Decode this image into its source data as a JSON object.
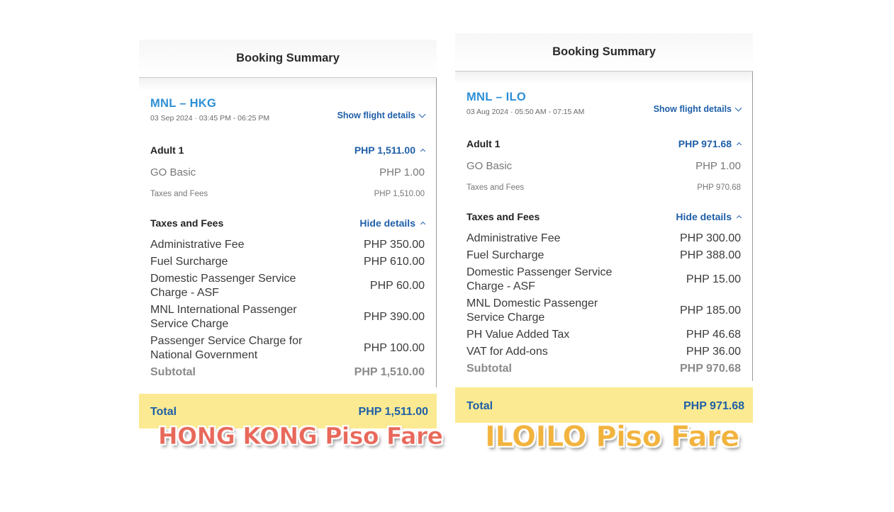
{
  "left": {
    "header": "Booking Summary",
    "route": "MNL – HKG",
    "flight_date": "03 Sep 2024 · 03:45 PM - 06:25 PM",
    "show_flight_details": "Show flight details",
    "adult_label": "Adult 1",
    "adult_amount": "PHP 1,511.00",
    "fare_label": "GO Basic",
    "fare_amount": "PHP 1.00",
    "taxes_label": "Taxes and Fees",
    "taxes_amount": "PHP 1,510.00",
    "taxes_head": "Taxes and Fees",
    "hide_details": "Hide details",
    "fees": [
      {
        "label": "Administrative Fee",
        "amount": "PHP 350.00"
      },
      {
        "label": "Fuel Surcharge",
        "amount": "PHP 610.00"
      },
      {
        "label": "Domestic Passenger Service Charge - ASF",
        "amount": "PHP 60.00"
      },
      {
        "label": "MNL International Passenger Service Charge",
        "amount": "PHP 390.00"
      },
      {
        "label": "Passenger Service Charge for National Government",
        "amount": "PHP 100.00"
      }
    ],
    "subtotal_label": "Subtotal",
    "subtotal_amount": "PHP 1,510.00",
    "total_label": "Total",
    "total_amount": "PHP 1,511.00",
    "caption": "HONG KONG Piso Fare"
  },
  "right": {
    "header": "Booking Summary",
    "route": "MNL – ILO",
    "flight_date": "03 Aug 2024 · 05:50 AM - 07:15 AM",
    "show_flight_details": "Show flight details",
    "adult_label": "Adult 1",
    "adult_amount": "PHP 971.68",
    "fare_label": "GO Basic",
    "fare_amount": "PHP 1.00",
    "taxes_label": "Taxes and Fees",
    "taxes_amount": "PHP 970.68",
    "taxes_head": "Taxes and Fees",
    "hide_details": "Hide details",
    "fees": [
      {
        "label": "Administrative Fee",
        "amount": "PHP 300.00"
      },
      {
        "label": "Fuel Surcharge",
        "amount": "PHP 388.00"
      },
      {
        "label": "Domestic Passenger Service Charge - ASF",
        "amount": "PHP 15.00"
      },
      {
        "label": "MNL Domestic Passenger Service Charge",
        "amount": "PHP 185.00"
      },
      {
        "label": "PH Value Added Tax",
        "amount": "PHP 46.68"
      },
      {
        "label": "VAT for Add-ons",
        "amount": "PHP 36.00"
      }
    ],
    "subtotal_label": "Subtotal",
    "subtotal_amount": "PHP 970.68",
    "total_label": "Total",
    "total_amount": "PHP 971.68",
    "caption": "ILOILO Piso Fare"
  },
  "colors": {
    "accent_blue": "#1f5fa8",
    "route_blue": "#2d8fd5",
    "total_bar": "#fbea91",
    "caption_left": "#e8685a",
    "caption_right": "#f2b33d"
  }
}
